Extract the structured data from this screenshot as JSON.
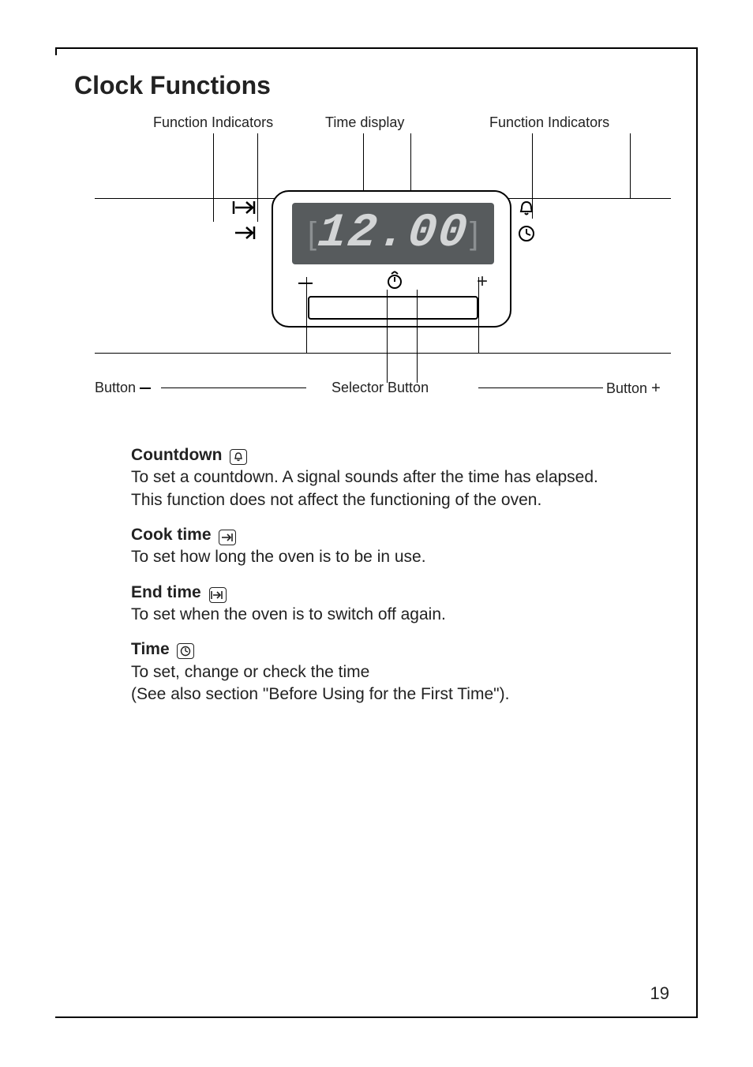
{
  "page": {
    "title": "Clock Functions",
    "number": "19"
  },
  "diagram": {
    "labels": {
      "fi_left": "Function Indicators",
      "time_display": "Time display",
      "fi_right": "Function Indicators",
      "btn_minus": "Button",
      "selector": "Selector Button",
      "btn_plus": "Button"
    },
    "lcd_value": "12.00",
    "panel_buttons": {
      "minus": "—",
      "clock": "clock-icon",
      "plus": "+"
    },
    "left_indicator_icons": [
      "end-time-icon",
      "cook-time-icon"
    ],
    "right_indicator_icons": [
      "bell-icon",
      "time-icon"
    ]
  },
  "functions": {
    "countdown": {
      "heading": "Countdown",
      "icon": "bell-icon",
      "text1": "To set a countdown. A signal sounds after the time has elapsed.",
      "text2": "This function does not affect the functioning of the oven."
    },
    "cooktime": {
      "heading": "Cook time",
      "icon": "cook-time-icon",
      "text": "To set how long the oven is to be in use."
    },
    "endtime": {
      "heading": "End time",
      "icon": "end-time-icon",
      "text": "To set when the oven is to switch off again."
    },
    "time": {
      "heading": "Time",
      "icon": "time-icon",
      "text1": "To set, change or check the time",
      "text2": "(See also section \"Before Using for the First Time\")."
    }
  }
}
